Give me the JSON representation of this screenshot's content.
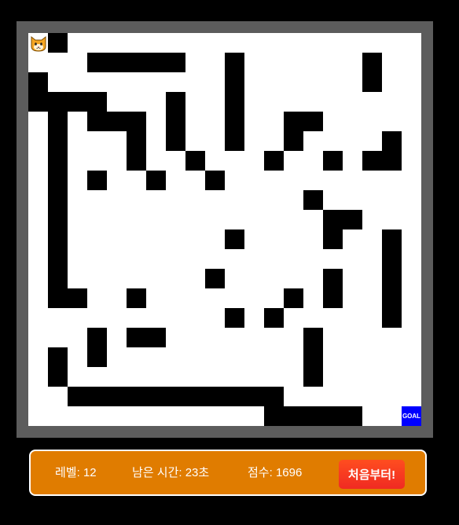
{
  "maze": {
    "colors": {
      "path": "#ffffff",
      "wall": "#000000",
      "frame": "#5c5c5c",
      "goal": "#0000ff"
    },
    "goal_label": "GOAL",
    "player_icon": "cat-face-icon"
  },
  "hud": {
    "background": "#e07c00",
    "level_label": "레벨:",
    "level_value": "12",
    "time_label": "남은 시간:",
    "time_value": "23초",
    "score_label": "점수:",
    "score_value": "1696",
    "restart_label": "처음부터!"
  }
}
